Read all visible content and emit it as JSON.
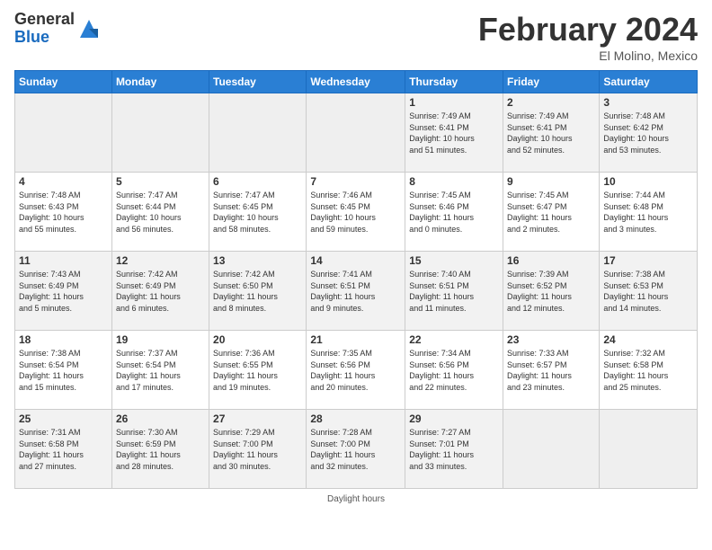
{
  "logo": {
    "general": "General",
    "blue": "Blue"
  },
  "title": "February 2024",
  "location": "El Molino, Mexico",
  "days_header": [
    "Sunday",
    "Monday",
    "Tuesday",
    "Wednesday",
    "Thursday",
    "Friday",
    "Saturday"
  ],
  "weeks": [
    [
      {
        "day": "",
        "info": ""
      },
      {
        "day": "",
        "info": ""
      },
      {
        "day": "",
        "info": ""
      },
      {
        "day": "",
        "info": ""
      },
      {
        "day": "1",
        "info": "Sunrise: 7:49 AM\nSunset: 6:41 PM\nDaylight: 10 hours\nand 51 minutes."
      },
      {
        "day": "2",
        "info": "Sunrise: 7:49 AM\nSunset: 6:41 PM\nDaylight: 10 hours\nand 52 minutes."
      },
      {
        "day": "3",
        "info": "Sunrise: 7:48 AM\nSunset: 6:42 PM\nDaylight: 10 hours\nand 53 minutes."
      }
    ],
    [
      {
        "day": "4",
        "info": "Sunrise: 7:48 AM\nSunset: 6:43 PM\nDaylight: 10 hours\nand 55 minutes."
      },
      {
        "day": "5",
        "info": "Sunrise: 7:47 AM\nSunset: 6:44 PM\nDaylight: 10 hours\nand 56 minutes."
      },
      {
        "day": "6",
        "info": "Sunrise: 7:47 AM\nSunset: 6:45 PM\nDaylight: 10 hours\nand 58 minutes."
      },
      {
        "day": "7",
        "info": "Sunrise: 7:46 AM\nSunset: 6:45 PM\nDaylight: 10 hours\nand 59 minutes."
      },
      {
        "day": "8",
        "info": "Sunrise: 7:45 AM\nSunset: 6:46 PM\nDaylight: 11 hours\nand 0 minutes."
      },
      {
        "day": "9",
        "info": "Sunrise: 7:45 AM\nSunset: 6:47 PM\nDaylight: 11 hours\nand 2 minutes."
      },
      {
        "day": "10",
        "info": "Sunrise: 7:44 AM\nSunset: 6:48 PM\nDaylight: 11 hours\nand 3 minutes."
      }
    ],
    [
      {
        "day": "11",
        "info": "Sunrise: 7:43 AM\nSunset: 6:49 PM\nDaylight: 11 hours\nand 5 minutes."
      },
      {
        "day": "12",
        "info": "Sunrise: 7:42 AM\nSunset: 6:49 PM\nDaylight: 11 hours\nand 6 minutes."
      },
      {
        "day": "13",
        "info": "Sunrise: 7:42 AM\nSunset: 6:50 PM\nDaylight: 11 hours\nand 8 minutes."
      },
      {
        "day": "14",
        "info": "Sunrise: 7:41 AM\nSunset: 6:51 PM\nDaylight: 11 hours\nand 9 minutes."
      },
      {
        "day": "15",
        "info": "Sunrise: 7:40 AM\nSunset: 6:51 PM\nDaylight: 11 hours\nand 11 minutes."
      },
      {
        "day": "16",
        "info": "Sunrise: 7:39 AM\nSunset: 6:52 PM\nDaylight: 11 hours\nand 12 minutes."
      },
      {
        "day": "17",
        "info": "Sunrise: 7:38 AM\nSunset: 6:53 PM\nDaylight: 11 hours\nand 14 minutes."
      }
    ],
    [
      {
        "day": "18",
        "info": "Sunrise: 7:38 AM\nSunset: 6:54 PM\nDaylight: 11 hours\nand 15 minutes."
      },
      {
        "day": "19",
        "info": "Sunrise: 7:37 AM\nSunset: 6:54 PM\nDaylight: 11 hours\nand 17 minutes."
      },
      {
        "day": "20",
        "info": "Sunrise: 7:36 AM\nSunset: 6:55 PM\nDaylight: 11 hours\nand 19 minutes."
      },
      {
        "day": "21",
        "info": "Sunrise: 7:35 AM\nSunset: 6:56 PM\nDaylight: 11 hours\nand 20 minutes."
      },
      {
        "day": "22",
        "info": "Sunrise: 7:34 AM\nSunset: 6:56 PM\nDaylight: 11 hours\nand 22 minutes."
      },
      {
        "day": "23",
        "info": "Sunrise: 7:33 AM\nSunset: 6:57 PM\nDaylight: 11 hours\nand 23 minutes."
      },
      {
        "day": "24",
        "info": "Sunrise: 7:32 AM\nSunset: 6:58 PM\nDaylight: 11 hours\nand 25 minutes."
      }
    ],
    [
      {
        "day": "25",
        "info": "Sunrise: 7:31 AM\nSunset: 6:58 PM\nDaylight: 11 hours\nand 27 minutes."
      },
      {
        "day": "26",
        "info": "Sunrise: 7:30 AM\nSunset: 6:59 PM\nDaylight: 11 hours\nand 28 minutes."
      },
      {
        "day": "27",
        "info": "Sunrise: 7:29 AM\nSunset: 7:00 PM\nDaylight: 11 hours\nand 30 minutes."
      },
      {
        "day": "28",
        "info": "Sunrise: 7:28 AM\nSunset: 7:00 PM\nDaylight: 11 hours\nand 32 minutes."
      },
      {
        "day": "29",
        "info": "Sunrise: 7:27 AM\nSunset: 7:01 PM\nDaylight: 11 hours\nand 33 minutes."
      },
      {
        "day": "",
        "info": ""
      },
      {
        "day": "",
        "info": ""
      }
    ]
  ],
  "footer": "Daylight hours"
}
